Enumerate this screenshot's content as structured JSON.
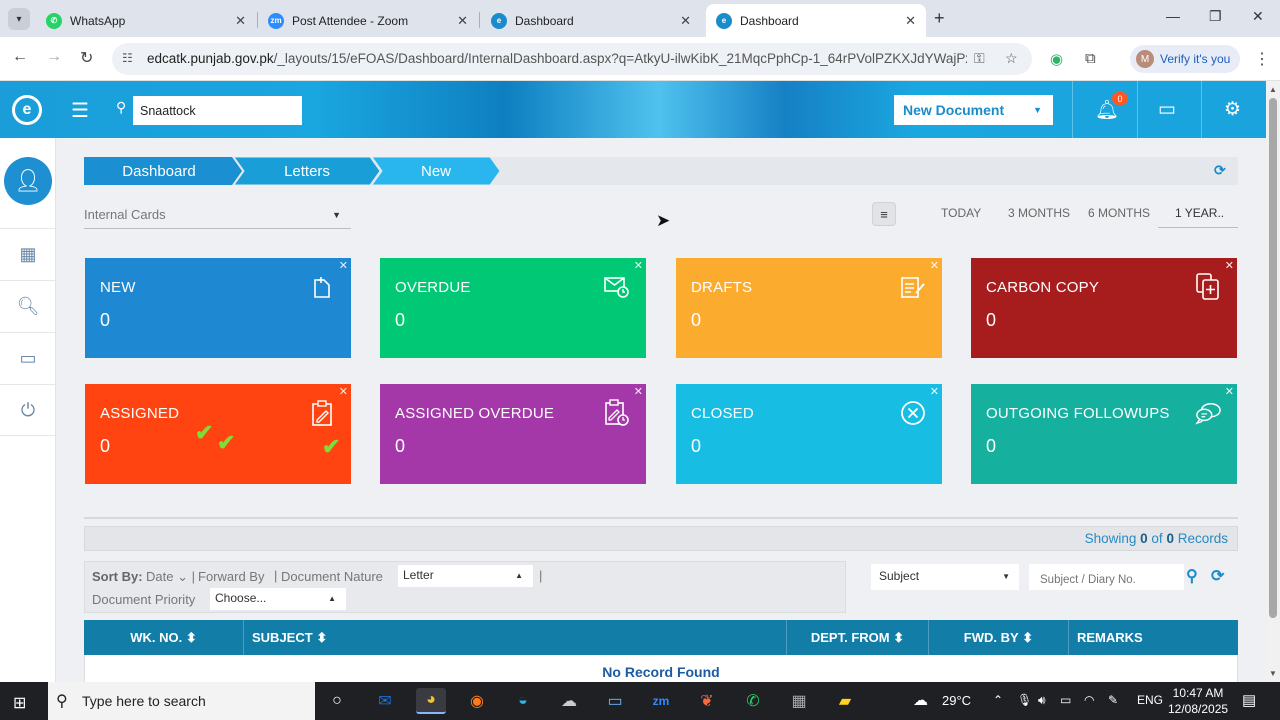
{
  "browser": {
    "tabs": [
      {
        "label": "WhatsApp",
        "favicon": "whatsapp-icon",
        "color": "#25d366"
      },
      {
        "label": "Post Attendee - Zoom",
        "favicon": "zoom-icon",
        "color": "#2d8cff"
      },
      {
        "label": "Dashboard",
        "favicon": "efoas-icon",
        "color": "#1a8ccb"
      },
      {
        "label": "Dashboard",
        "favicon": "efoas-icon",
        "color": "#1a8ccb",
        "active": true
      }
    ],
    "url_host": "edcatk.punjab.gov.pk",
    "url_path": "/_layouts/15/eFOAS/Dashboard/InternalDashboard.aspx?q=AtkyU-ilwKibK_21MqcPphCp-1_64rPVolPZKXJdYWajPxKCw...",
    "profile_initial": "M",
    "verify_label": "Verify it's you"
  },
  "header": {
    "search_value": "Snaattock",
    "new_document_label": "New Document",
    "notifications_count": "0"
  },
  "breadcrumb": [
    "Dashboard",
    "Letters",
    "New"
  ],
  "filters": {
    "cards_select": "Internal Cards",
    "ranges": [
      "TODAY",
      "3 MONTHS",
      "6 MONTHS",
      "1 YEAR.."
    ],
    "active_range": "1 YEAR.."
  },
  "cards": [
    {
      "title": "NEW",
      "value": "0",
      "color": "#1e88d2",
      "icon": "new-document-icon"
    },
    {
      "title": "OVERDUE",
      "value": "0",
      "color": "#00c875",
      "icon": "mail-clock-icon"
    },
    {
      "title": "DRAFTS",
      "value": "0",
      "color": "#fbab2e",
      "icon": "draft-edit-icon"
    },
    {
      "title": "CARBON COPY",
      "value": "0",
      "color": "#a71d1d",
      "icon": "copy-file-icon"
    },
    {
      "title": "ASSIGNED",
      "value": "0",
      "color": "#ff4411",
      "icon": "clipboard-edit-icon"
    },
    {
      "title": "ASSIGNED OVERDUE",
      "value": "0",
      "color": "#a438a8",
      "icon": "clipboard-clock-icon"
    },
    {
      "title": "CLOSED",
      "value": "0",
      "color": "#17bde3",
      "icon": "close-circle-icon"
    },
    {
      "title": "OUTGOING FOLLOWUPS",
      "value": "0",
      "color": "#16b09f",
      "icon": "chat-bubbles-icon"
    }
  ],
  "records": {
    "prefix": "Showing",
    "shown": "0",
    "of": "of",
    "total": "0",
    "suffix": "Records"
  },
  "sort": {
    "label": "Sort By:",
    "date": "Date",
    "forward_by": "Forward By",
    "document_nature": "Document Nature",
    "nature_value": "Letter",
    "priority_label": "Document Priority",
    "priority_value": "Choose..."
  },
  "search_panel": {
    "subject_value": "Subject",
    "diary_placeholder": "Subject / Diary No."
  },
  "table": {
    "columns": [
      "WK. NO.",
      "SUBJECT",
      "DEPT. FROM",
      "FWD. BY",
      "REMARKS"
    ],
    "empty_message": "No Record Found"
  },
  "taskbar": {
    "search_placeholder": "Type here to search",
    "weather": "29°C",
    "language": "ENG",
    "time": "10:47 AM",
    "date": "12/08/2025"
  }
}
